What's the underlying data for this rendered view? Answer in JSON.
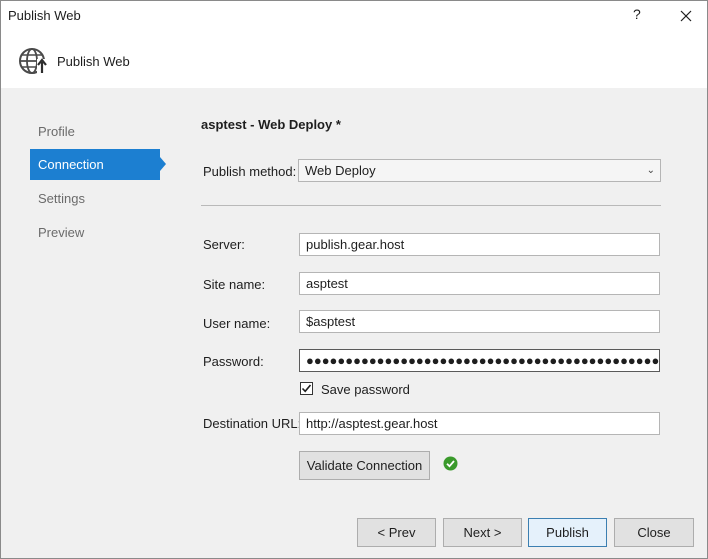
{
  "window": {
    "title": "Publish Web",
    "help_label": "?"
  },
  "header": {
    "title": "Publish Web",
    "icon": "globe-publish-icon"
  },
  "sidebar": {
    "items": [
      {
        "label": "Profile"
      },
      {
        "label": "Connection",
        "active": true
      },
      {
        "label": "Settings"
      },
      {
        "label": "Preview"
      }
    ]
  },
  "main": {
    "profile_title": "asptest - Web Deploy *",
    "publish_method": {
      "label": "Publish method:",
      "value": "Web Deploy"
    },
    "server": {
      "label": "Server:",
      "value": "publish.gear.host"
    },
    "site_name": {
      "label": "Site name:",
      "value": "asptest"
    },
    "user_name": {
      "label": "User name:",
      "value": "$asptest"
    },
    "password": {
      "label": "Password:",
      "value": "●●●●●●●●●●●●●●●●●●●●●●●●●●●●●●●●●●●●●●●●●●●●●●●●●●●●●●●●"
    },
    "save_password": {
      "label": "Save password",
      "checked": true
    },
    "destination_url": {
      "label": "Destination URL:",
      "value": "http://asptest.gear.host"
    },
    "validate_label": "Validate Connection",
    "validation_status": "success"
  },
  "footer": {
    "prev_label": "< Prev",
    "next_label": "Next >",
    "publish_label": "Publish",
    "close_label": "Close"
  },
  "colors": {
    "accent": "#1c7fd1",
    "success": "#3a9a2b"
  }
}
